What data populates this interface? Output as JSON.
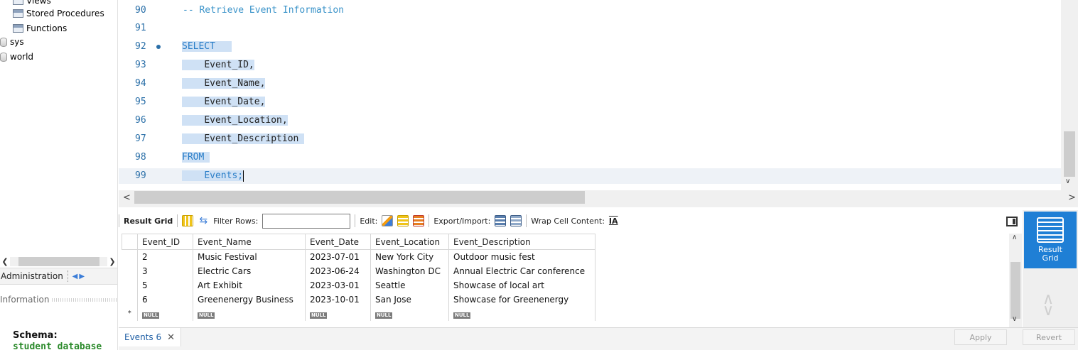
{
  "navigator": {
    "tree": [
      {
        "label": "Views",
        "icon": "table-icon"
      },
      {
        "label": "Stored Procedures",
        "icon": "table-icon"
      },
      {
        "label": "Functions",
        "icon": "table-icon"
      },
      {
        "label": "sys",
        "icon": "database-icon"
      },
      {
        "label": "world",
        "icon": "database-icon"
      }
    ],
    "tabs": {
      "administration": "Administration"
    },
    "info_label": "Information",
    "schema_label": "Schema:",
    "schema_value": "student_database"
  },
  "editor": {
    "lines": [
      {
        "num": "90",
        "text": "-- Retrieve Event Information"
      },
      {
        "num": "91",
        "text": ""
      },
      {
        "num": "92",
        "text": "SELECT"
      },
      {
        "num": "93",
        "text": "Event_ID,"
      },
      {
        "num": "94",
        "text": "Event_Name,"
      },
      {
        "num": "95",
        "text": "Event_Date,"
      },
      {
        "num": "96",
        "text": "Event_Location,"
      },
      {
        "num": "97",
        "text": "Event_Description"
      },
      {
        "num": "98",
        "text": "FROM"
      },
      {
        "num": "99",
        "text": "Events;"
      }
    ]
  },
  "result_toolbar": {
    "result_grid": "Result Grid",
    "filter_rows": "Filter Rows:",
    "filter_value": "",
    "edit": "Edit:",
    "export_import": "Export/Import:",
    "wrap_cell": "Wrap Cell Content:"
  },
  "grid": {
    "columns": [
      "Event_ID",
      "Event_Name",
      "Event_Date",
      "Event_Location",
      "Event_Description"
    ],
    "rows": [
      [
        "2",
        "Music Festival",
        "2023-07-01",
        "New York City",
        "Outdoor music fest"
      ],
      [
        "3",
        "Electric Cars",
        "2023-06-24",
        "Washington DC",
        "Annual Electric Car conference"
      ],
      [
        "5",
        "Art Exhibit",
        "2023-03-01",
        "Seattle",
        "Showcase of local art"
      ],
      [
        "6",
        "Greenenergy Business",
        "2023-10-01",
        "San Jose",
        "Showcase for Greenenergy"
      ]
    ],
    "null_label": "NULL",
    "new_row_marker": "*"
  },
  "side_panel": {
    "active": "Result Grid"
  },
  "bottom": {
    "tab_label": "Events 6",
    "apply": "Apply",
    "revert": "Revert"
  },
  "colors": {
    "accent": "#1f7fd5",
    "selection": "#cfe1f5",
    "keyword": "#2a7ec8",
    "line_number": "#2a6fa8",
    "schema_value": "#2b8a2b"
  }
}
